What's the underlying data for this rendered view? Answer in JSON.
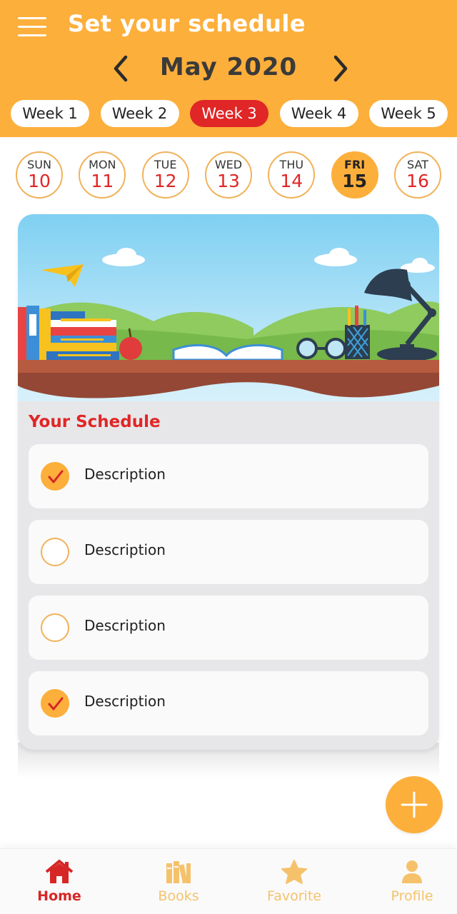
{
  "header": {
    "title": "Set your schedule",
    "month": "May 2020",
    "background_color": "#FDAF3B",
    "menu_icon": "hamburger-menu-icon",
    "prev_icon": "chevron-left-icon",
    "next_icon": "chevron-right-icon"
  },
  "weeks": [
    {
      "label": "Week 1",
      "active": false
    },
    {
      "label": "Week 2",
      "active": false
    },
    {
      "label": "Week 3",
      "active": true
    },
    {
      "label": "Week 4",
      "active": false
    },
    {
      "label": "Week 5",
      "active": false
    }
  ],
  "days": [
    {
      "name": "SUN",
      "number": "10",
      "selected": false
    },
    {
      "name": "MON",
      "number": "11",
      "selected": false
    },
    {
      "name": "TUE",
      "number": "12",
      "selected": false
    },
    {
      "name": "WED",
      "number": "13",
      "selected": false
    },
    {
      "name": "THU",
      "number": "14",
      "selected": false
    },
    {
      "name": "FRI",
      "number": "15",
      "selected": true
    },
    {
      "name": "SAT",
      "number": "16",
      "selected": false
    }
  ],
  "schedule": {
    "title": "Your Schedule",
    "items": [
      {
        "label": "Description",
        "checked": true
      },
      {
        "label": "Description",
        "checked": false
      },
      {
        "label": "Description",
        "checked": false
      },
      {
        "label": "Description",
        "checked": true
      }
    ]
  },
  "fab": {
    "icon": "plus-icon"
  },
  "bottom_nav": [
    {
      "label": "Home",
      "icon": "home-icon",
      "active": true
    },
    {
      "label": "Books",
      "icon": "books-icon",
      "active": false
    },
    {
      "label": "Favorite",
      "icon": "star-icon",
      "active": false
    },
    {
      "label": "Profile",
      "icon": "user-icon",
      "active": false
    }
  ],
  "colors": {
    "accent": "#FDAF3B",
    "active_red": "#E02626",
    "inactive_nav": "#F5C26B",
    "card_background": "#E7E7E9"
  }
}
